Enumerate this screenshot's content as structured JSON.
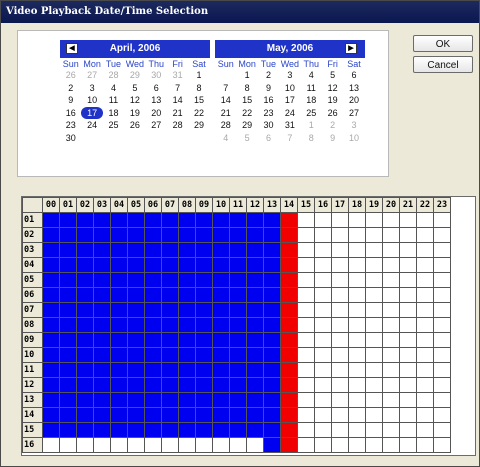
{
  "window": {
    "title": "Video Playback Date/Time Selection"
  },
  "buttons": {
    "ok": "OK",
    "cancel": "Cancel"
  },
  "calendar": {
    "dow": [
      "Sun",
      "Mon",
      "Tue",
      "Wed",
      "Thu",
      "Fri",
      "Sat"
    ],
    "months": [
      {
        "label": "April, 2006",
        "nav": "◀",
        "weeks": [
          [
            {
              "d": "26",
              "o": 1
            },
            {
              "d": "27",
              "o": 1
            },
            {
              "d": "28",
              "o": 1
            },
            {
              "d": "29",
              "o": 1
            },
            {
              "d": "30",
              "o": 1
            },
            {
              "d": "31",
              "o": 1
            },
            {
              "d": "1",
              "o": 0
            }
          ],
          [
            {
              "d": "2",
              "o": 0
            },
            {
              "d": "3",
              "o": 0
            },
            {
              "d": "4",
              "o": 0
            },
            {
              "d": "5",
              "o": 0
            },
            {
              "d": "6",
              "o": 0
            },
            {
              "d": "7",
              "o": 0
            },
            {
              "d": "8",
              "o": 0
            }
          ],
          [
            {
              "d": "9",
              "o": 0
            },
            {
              "d": "10",
              "o": 0
            },
            {
              "d": "11",
              "o": 0
            },
            {
              "d": "12",
              "o": 0
            },
            {
              "d": "13",
              "o": 0
            },
            {
              "d": "14",
              "o": 0
            },
            {
              "d": "15",
              "o": 0
            }
          ],
          [
            {
              "d": "16",
              "o": 0
            },
            {
              "d": "17",
              "o": 0,
              "s": 1
            },
            {
              "d": "18",
              "o": 0
            },
            {
              "d": "19",
              "o": 0
            },
            {
              "d": "20",
              "o": 0
            },
            {
              "d": "21",
              "o": 0
            },
            {
              "d": "22",
              "o": 0
            }
          ],
          [
            {
              "d": "23",
              "o": 0
            },
            {
              "d": "24",
              "o": 0
            },
            {
              "d": "25",
              "o": 0
            },
            {
              "d": "26",
              "o": 0
            },
            {
              "d": "27",
              "o": 0
            },
            {
              "d": "28",
              "o": 0
            },
            {
              "d": "29",
              "o": 0
            }
          ],
          [
            {
              "d": "30",
              "o": 0
            },
            {
              "d": "",
              "o": 0
            },
            {
              "d": "",
              "o": 0
            },
            {
              "d": "",
              "o": 0
            },
            {
              "d": "",
              "o": 0
            },
            {
              "d": "",
              "o": 0
            },
            {
              "d": "",
              "o": 0
            }
          ]
        ]
      },
      {
        "label": "May, 2006",
        "nav": "▶",
        "weeks": [
          [
            {
              "d": "",
              "o": 0
            },
            {
              "d": "1",
              "o": 0
            },
            {
              "d": "2",
              "o": 0
            },
            {
              "d": "3",
              "o": 0
            },
            {
              "d": "4",
              "o": 0
            },
            {
              "d": "5",
              "o": 0
            },
            {
              "d": "6",
              "o": 0
            }
          ],
          [
            {
              "d": "7",
              "o": 0
            },
            {
              "d": "8",
              "o": 0
            },
            {
              "d": "9",
              "o": 0
            },
            {
              "d": "10",
              "o": 0
            },
            {
              "d": "11",
              "o": 0
            },
            {
              "d": "12",
              "o": 0
            },
            {
              "d": "13",
              "o": 0
            }
          ],
          [
            {
              "d": "14",
              "o": 0
            },
            {
              "d": "15",
              "o": 0
            },
            {
              "d": "16",
              "o": 0
            },
            {
              "d": "17",
              "o": 0
            },
            {
              "d": "18",
              "o": 0
            },
            {
              "d": "19",
              "o": 0
            },
            {
              "d": "20",
              "o": 0
            }
          ],
          [
            {
              "d": "21",
              "o": 0
            },
            {
              "d": "22",
              "o": 0
            },
            {
              "d": "23",
              "o": 0
            },
            {
              "d": "24",
              "o": 0
            },
            {
              "d": "25",
              "o": 0
            },
            {
              "d": "26",
              "o": 0
            },
            {
              "d": "27",
              "o": 0
            }
          ],
          [
            {
              "d": "28",
              "o": 0
            },
            {
              "d": "29",
              "o": 0
            },
            {
              "d": "30",
              "o": 0
            },
            {
              "d": "31",
              "o": 0
            },
            {
              "d": "1",
              "o": 1
            },
            {
              "d": "2",
              "o": 1
            },
            {
              "d": "3",
              "o": 1
            }
          ],
          [
            {
              "d": "4",
              "o": 1
            },
            {
              "d": "5",
              "o": 1
            },
            {
              "d": "6",
              "o": 1
            },
            {
              "d": "7",
              "o": 1
            },
            {
              "d": "8",
              "o": 1
            },
            {
              "d": "9",
              "o": 1
            },
            {
              "d": "10",
              "o": 1
            }
          ]
        ]
      }
    ]
  },
  "grid": {
    "cols": [
      "00",
      "01",
      "02",
      "03",
      "04",
      "05",
      "06",
      "07",
      "08",
      "09",
      "10",
      "11",
      "12",
      "13",
      "14",
      "15",
      "16",
      "17",
      "18",
      "19",
      "20",
      "21",
      "22",
      "23"
    ],
    "rows": [
      "01",
      "02",
      "03",
      "04",
      "05",
      "06",
      "07",
      "08",
      "09",
      "10",
      "11",
      "12",
      "13",
      "14",
      "15",
      "16"
    ],
    "colors": {
      "recorded": "#0000f0",
      "current": "#f00000",
      "empty": "#ffffff"
    },
    "recorded_cols_last": 13,
    "current_col": 14,
    "partial_row": "16",
    "partial_row_recorded_from": 13
  }
}
